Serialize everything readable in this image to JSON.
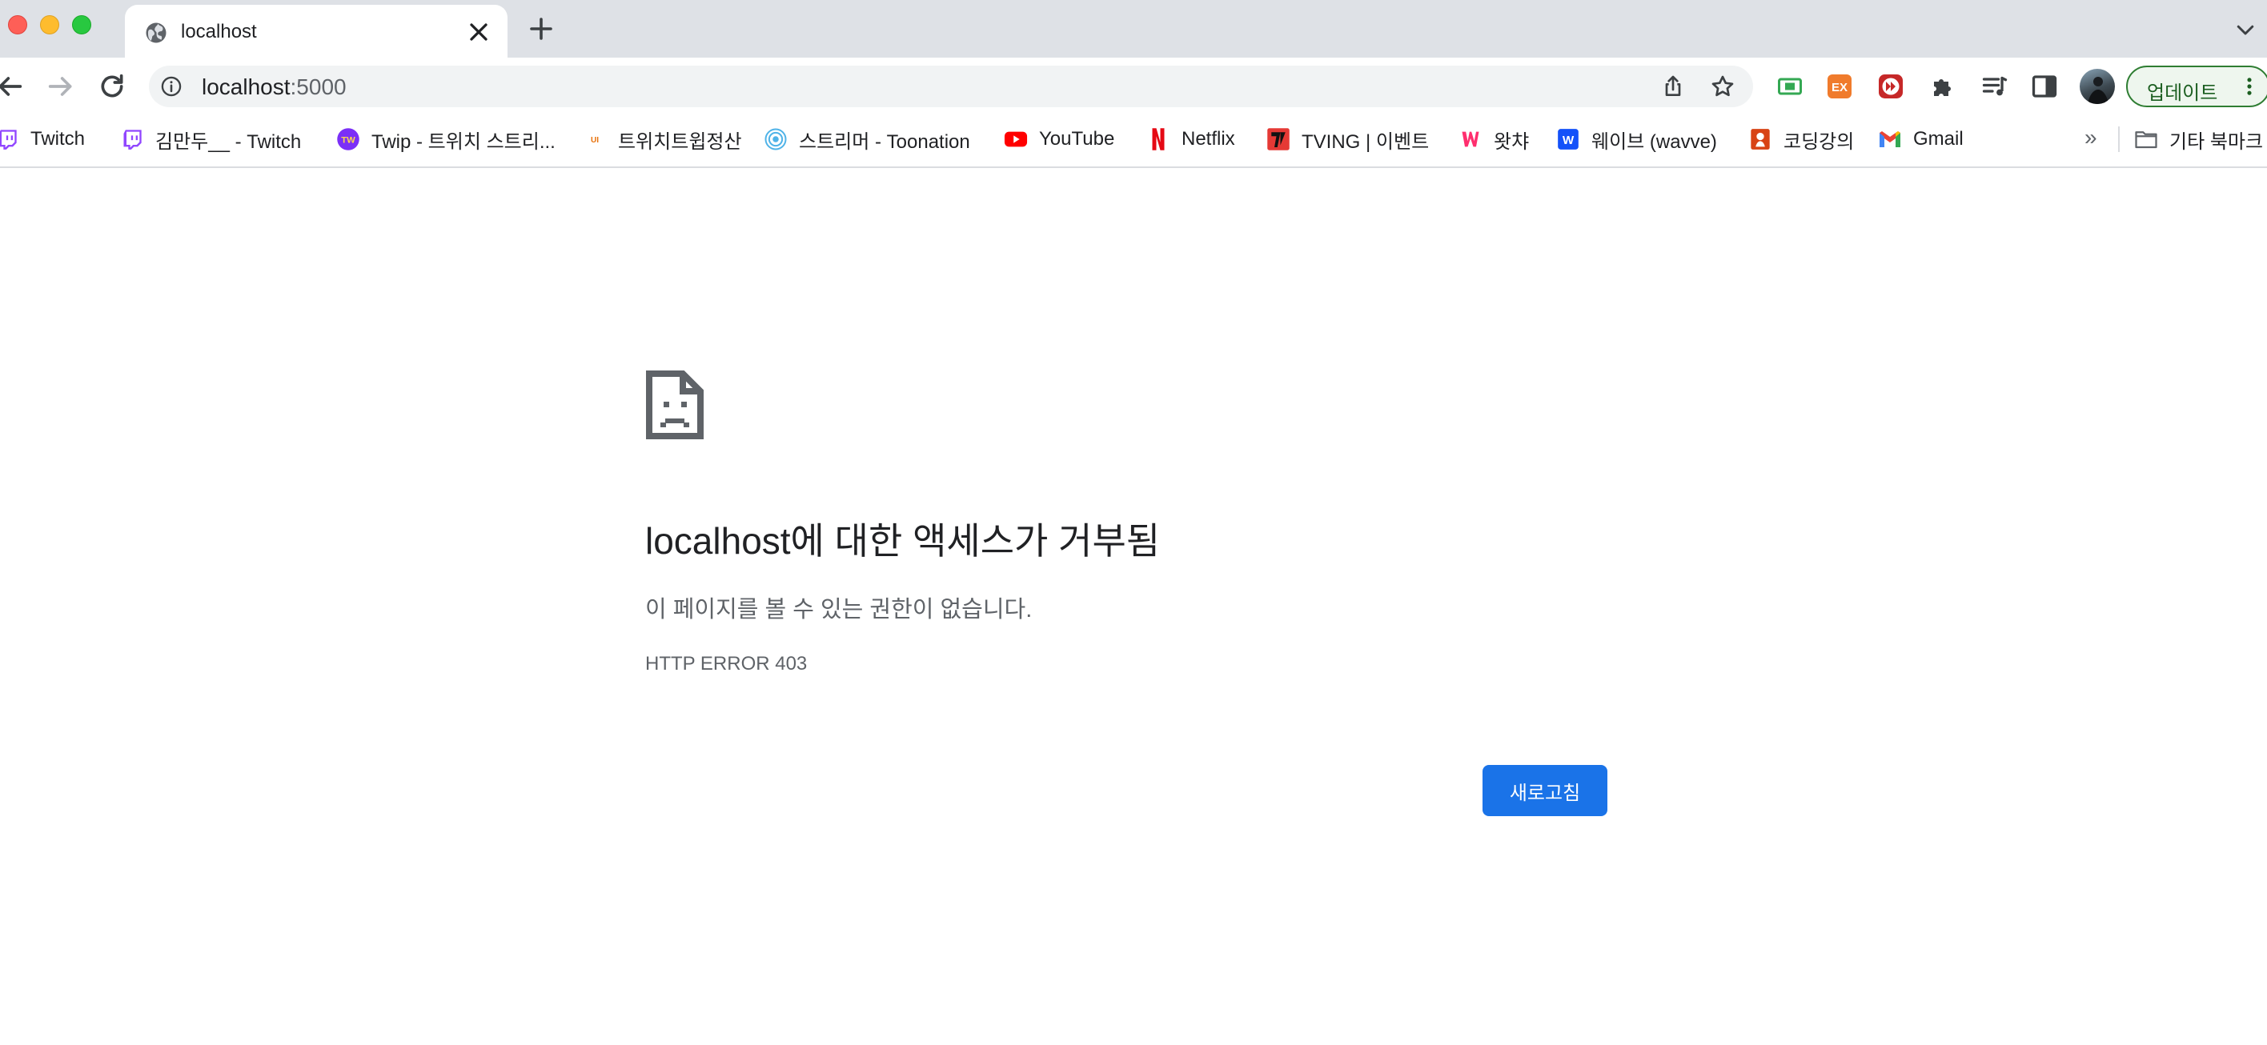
{
  "tab": {
    "title": "localhost"
  },
  "omnibox": {
    "host": "localhost",
    "port": ":5000"
  },
  "toolbar": {
    "update_label": "업데이트"
  },
  "bookmarks": [
    {
      "label": "Twitch",
      "icon": "twitch-icon"
    },
    {
      "label": "김만두__ - Twitch",
      "icon": "twitch-icon"
    },
    {
      "label": "Twip - 트위치 스트리...",
      "icon": "twip-icon"
    },
    {
      "label": "트위치트윕정산",
      "icon": "ui-icon"
    },
    {
      "label": "스트리머 - Toonation",
      "icon": "toonation-icon"
    },
    {
      "label": "YouTube",
      "icon": "youtube-icon"
    },
    {
      "label": "Netflix",
      "icon": "netflix-icon"
    },
    {
      "label": "TVING | 이벤트",
      "icon": "tving-icon"
    },
    {
      "label": "왓챠",
      "icon": "watcha-icon"
    },
    {
      "label": "웨이브 (wavve)",
      "icon": "wavve-icon"
    },
    {
      "label": "코딩강의",
      "icon": "coding-icon"
    },
    {
      "label": "Gmail",
      "icon": "gmail-icon"
    }
  ],
  "bookmarks_more": "»",
  "other_bookmarks": "기타 북마크",
  "error": {
    "title": "localhost에 대한 액세스가 거부됨",
    "description": "이 페이지를 볼 수 있는 권한이 없습니다.",
    "code": "HTTP ERROR 403",
    "reload_label": "새로고침"
  },
  "colors": {
    "accent": "#1a73e8",
    "tabstrip": "#dee1e6",
    "update_border": "#2e7d32"
  }
}
